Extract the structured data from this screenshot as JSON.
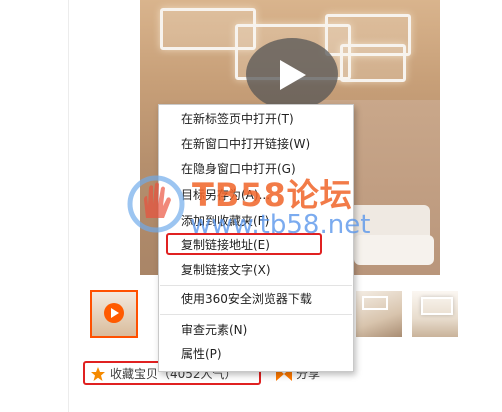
{
  "context_menu": {
    "items": [
      {
        "label": "在新标签页中打开(T)"
      },
      {
        "label": "在新窗口中打开链接(W)"
      },
      {
        "label": "在隐身窗口中打开(G)"
      },
      {
        "label": "目标另存为(A)..."
      },
      {
        "label": "添加到收藏夹(F)"
      },
      {
        "label": "复制链接地址(E)",
        "highlighted": true
      },
      {
        "label": "复制链接文字(X)"
      },
      {
        "label": "使用360安全浏览器下载"
      },
      {
        "label": "审查元素(N)"
      },
      {
        "label": "属性(P)"
      }
    ]
  },
  "actions": {
    "collect_label": "收藏宝贝（4052人气）",
    "share_label": "分享"
  },
  "watermark": {
    "title": "TB58论坛",
    "url": "www.tb58.net"
  },
  "icons": {
    "play": "play-icon",
    "star": "star-icon",
    "share": "share-icon",
    "hand": "hand-logo-icon"
  },
  "colors": {
    "highlight_border": "#e02121",
    "accent": "#ff5000",
    "star": "#f58a00"
  }
}
